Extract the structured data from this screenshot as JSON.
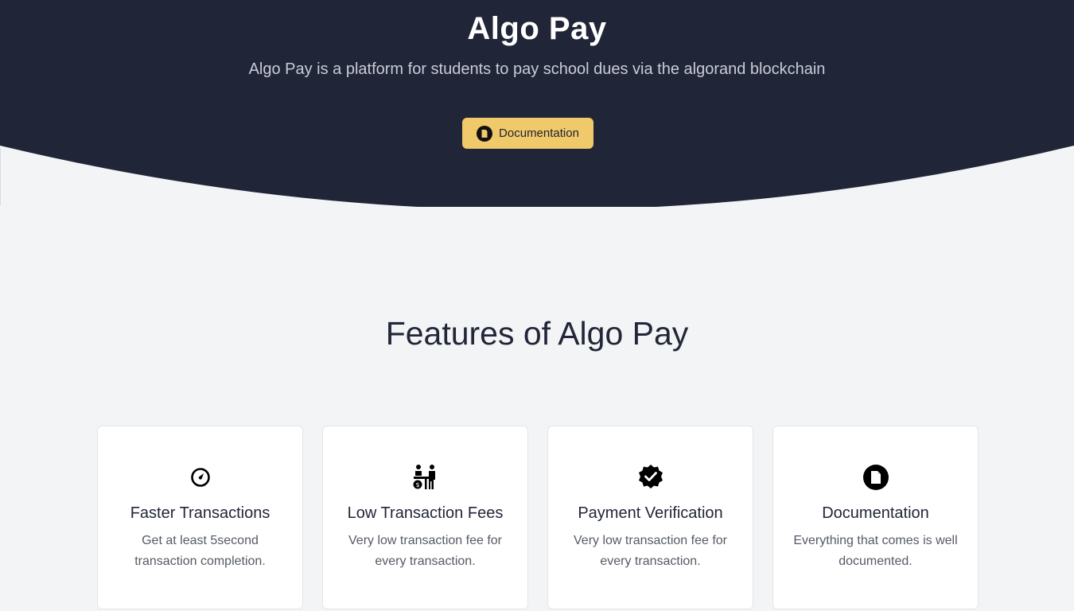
{
  "hero": {
    "title": "Algo Pay",
    "subtitle": "Algo Pay is a platform for students to pay school dues via the algorand blockchain",
    "button_label": "Documentation",
    "button_icon": "document-icon",
    "background_color": "#212538",
    "button_color": "#f0c96b"
  },
  "features": {
    "title": "Features of Algo Pay",
    "cards": [
      {
        "icon": "speed-gauge-icon",
        "title": "Faster Transactions",
        "description": "Get at least 5second transaction completion."
      },
      {
        "icon": "cashier-payment-icon",
        "title": "Low Transaction Fees",
        "description": "Very low transaction fee for every transaction."
      },
      {
        "icon": "verified-badge-icon",
        "title": "Payment Verification",
        "description": "Very low transaction fee for every transaction."
      },
      {
        "icon": "document-icon",
        "title": "Documentation",
        "description": "Everything that comes is well documented."
      }
    ]
  },
  "page_background": "#f3f4f6"
}
